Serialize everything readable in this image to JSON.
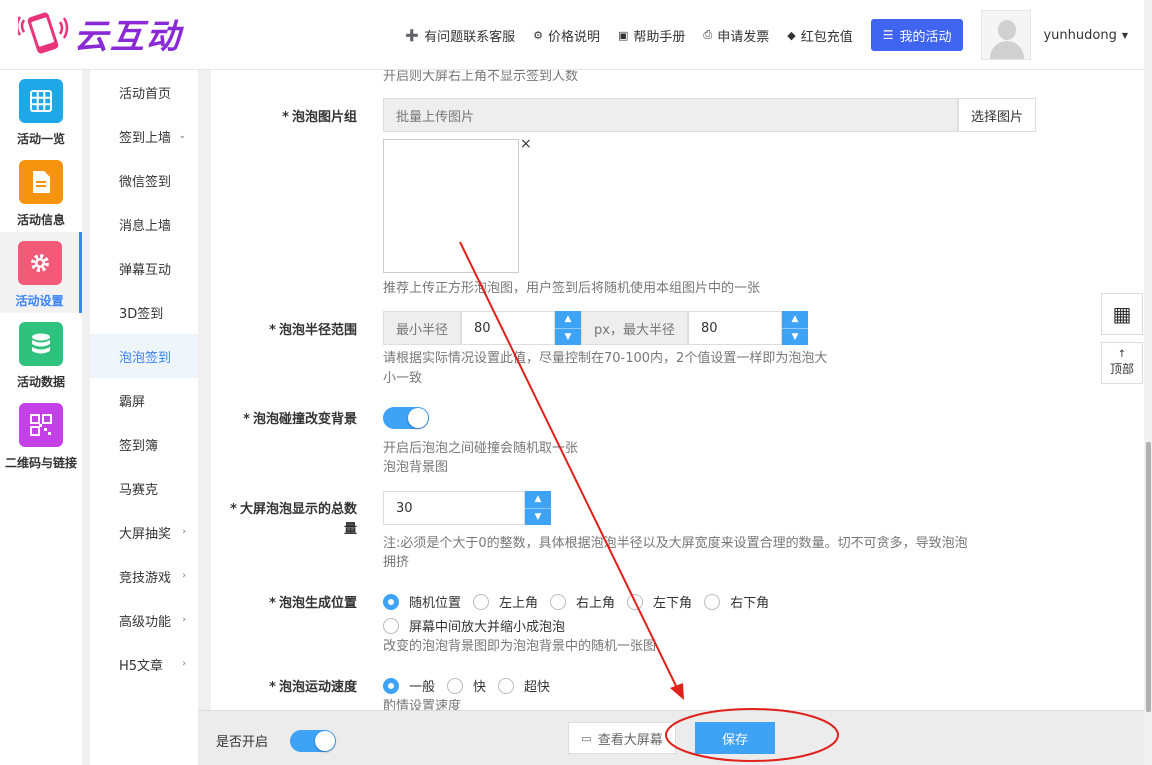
{
  "header": {
    "logo_text": "云互动",
    "nav": [
      {
        "icon": "user-plus-icon",
        "glyph": "➕",
        "label": "有问题联系客服"
      },
      {
        "icon": "gear-icon",
        "glyph": "⚙",
        "label": "价格说明"
      },
      {
        "icon": "book-icon",
        "glyph": "▣",
        "label": "帮助手册"
      },
      {
        "icon": "printer-icon",
        "glyph": "⎙",
        "label": "申请发票"
      },
      {
        "icon": "shield-icon",
        "glyph": "◆",
        "label": "红包充值"
      }
    ],
    "my_activity": "我的活动",
    "username": "yunhudong"
  },
  "icon_sidebar": [
    {
      "label": "活动一览",
      "icon": "grid-icon",
      "color": "#1fa8e8"
    },
    {
      "label": "活动信息",
      "icon": "document-icon",
      "color": "#f7940f"
    },
    {
      "label": "活动设置",
      "icon": "gear-icon",
      "color": "#f25a78"
    },
    {
      "label": "活动数据",
      "icon": "database-icon",
      "color": "#2ec27e"
    },
    {
      "label": "二维码与链接",
      "icon": "qrcode-icon",
      "color": "#c640e8"
    }
  ],
  "sub_sidebar": [
    {
      "label": "活动首页",
      "arrow": ""
    },
    {
      "label": "签到上墙",
      "arrow": "⌄"
    },
    {
      "label": "微信签到",
      "arrow": ""
    },
    {
      "label": "消息上墙",
      "arrow": ""
    },
    {
      "label": "弹幕互动",
      "arrow": ""
    },
    {
      "label": "3D签到",
      "arrow": ""
    },
    {
      "label": "泡泡签到",
      "arrow": ""
    },
    {
      "label": "霸屏",
      "arrow": ""
    },
    {
      "label": "签到簿",
      "arrow": ""
    },
    {
      "label": "马赛克",
      "arrow": ""
    },
    {
      "label": "大屏抽奖",
      "arrow": "›"
    },
    {
      "label": "竞技游戏",
      "arrow": "›"
    },
    {
      "label": "高级功能",
      "arrow": "›"
    },
    {
      "label": "H5文章",
      "arrow": "›"
    }
  ],
  "form": {
    "top_hint": "开启则大屏右上角不显示签到人数",
    "bubble_images": {
      "label": "泡泡图片组",
      "placeholder": "批量上传图片",
      "button": "选择图片",
      "close": "×",
      "hint": "推荐上传正方形泡泡图，用户签到后将随机使用本组图片中的一张"
    },
    "bubble_radius": {
      "label": "泡泡半径范围",
      "min_addon": "最小半径",
      "min_value": "80",
      "mid_addon": "px，最大半径",
      "max_value": "80",
      "hint1": "请根据实际情况设置此值，尽量控制在70-100内，2个值设置一样即为泡泡大",
      "hint2": "小一致"
    },
    "collision_bg": {
      "label": "泡泡碰撞改变背景",
      "on": true,
      "hint1": "开启后泡泡之间碰撞会随机取一张",
      "hint2": "泡泡背景图"
    },
    "total_count": {
      "label1": "大屏泡泡显示的总数",
      "label2": "量",
      "value": "30",
      "hint1": "注:必须是个大于0的整数，具体根据泡泡半径以及大屏宽度来设置合理的数量。切不可贪多，导致泡泡",
      "hint2": "拥挤"
    },
    "position": {
      "label": "泡泡生成位置",
      "options": [
        "随机位置",
        "左上角",
        "右上角",
        "左下角",
        "右下角"
      ],
      "option_extra": "屏幕中间放大并缩小成泡泡",
      "selected": 0,
      "hint": "改变的泡泡背景图即为泡泡背景中的随机一张图"
    },
    "speed": {
      "label": "泡泡运动速度",
      "options": [
        "一般",
        "快",
        "超快"
      ],
      "selected": 0,
      "hint": "酌情设置速度"
    }
  },
  "footer": {
    "enabled_label": "是否开启",
    "enabled": true,
    "view_screen": "查看大屏幕",
    "save": "保存"
  },
  "float_tools": {
    "qrcode_glyph": "▦",
    "top_arrow": "↑",
    "top_label": "顶部"
  },
  "req_mark": "*",
  "colors": {
    "accent": "#3ea2f5",
    "primary_button": "#3e64f0",
    "annotation": "#e0201a"
  }
}
